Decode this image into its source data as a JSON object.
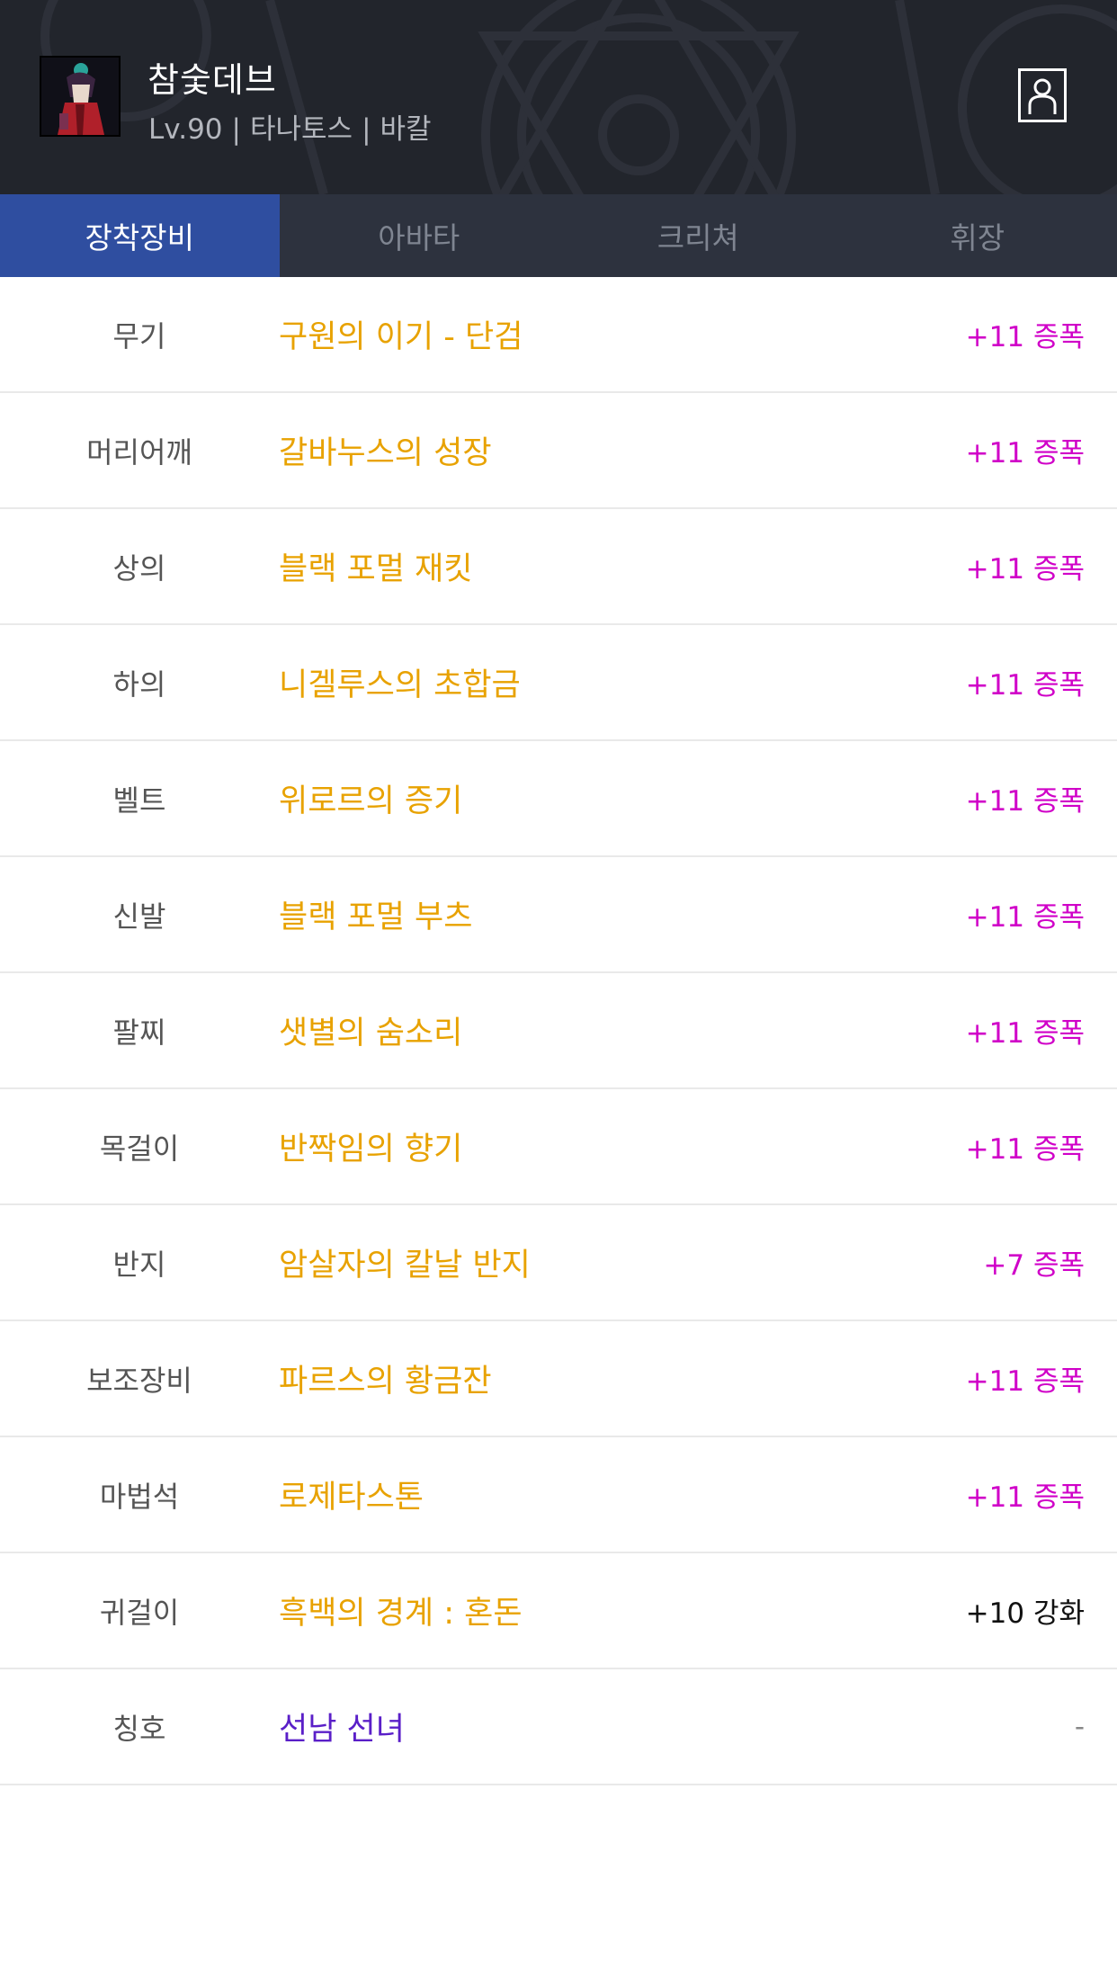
{
  "header": {
    "character_name": "참숯데브",
    "level": "Lv.90",
    "job": "타나토스",
    "server": "바칼",
    "separator": "|",
    "avatar_icon": "character-portrait-icon",
    "profile_icon": "person-outline-icon"
  },
  "tabs": [
    {
      "label": "장착장비",
      "active": true
    },
    {
      "label": "아바타",
      "active": false
    },
    {
      "label": "크리쳐",
      "active": false
    },
    {
      "label": "휘장",
      "active": false
    }
  ],
  "equipment": [
    {
      "slot": "무기",
      "name": "구원의 이기 - 단검",
      "tag": "+11 증폭",
      "tag_style": "amplify"
    },
    {
      "slot": "머리어깨",
      "name": "갈바누스의 성장",
      "tag": "+11 증폭",
      "tag_style": "amplify"
    },
    {
      "slot": "상의",
      "name": "블랙 포멀 재킷",
      "tag": "+11 증폭",
      "tag_style": "amplify"
    },
    {
      "slot": "하의",
      "name": "니겔루스의 초합금",
      "tag": "+11 증폭",
      "tag_style": "amplify"
    },
    {
      "slot": "벨트",
      "name": "위로르의 증기",
      "tag": "+11 증폭",
      "tag_style": "amplify"
    },
    {
      "slot": "신발",
      "name": "블랙 포멀 부츠",
      "tag": "+11 증폭",
      "tag_style": "amplify"
    },
    {
      "slot": "팔찌",
      "name": "샛별의 숨소리",
      "tag": "+11 증폭",
      "tag_style": "amplify"
    },
    {
      "slot": "목걸이",
      "name": "반짝임의 향기",
      "tag": "+11 증폭",
      "tag_style": "amplify"
    },
    {
      "slot": "반지",
      "name": "암살자의 칼날 반지",
      "tag": "+7 증폭",
      "tag_style": "amplify"
    },
    {
      "slot": "보조장비",
      "name": "파르스의 황금잔",
      "tag": "+11 증폭",
      "tag_style": "amplify"
    },
    {
      "slot": "마법석",
      "name": "로제타스톤",
      "tag": "+11 증폭",
      "tag_style": "amplify"
    },
    {
      "slot": "귀걸이",
      "name": "흑백의 경계 : 혼돈",
      "tag": "+10 강화",
      "tag_style": "reinforce"
    },
    {
      "slot": "칭호",
      "name": "선남 선녀",
      "tag": "-",
      "tag_style": "none"
    }
  ],
  "colors": {
    "header_bg": "#22252c",
    "tab_bar_bg": "#2d323e",
    "tab_active_bg": "#2f4ea0",
    "item_unique": "#e8a200",
    "item_rare_title": "#5a1fc8",
    "amplify": "#d000c8",
    "reinforce": "#111111"
  }
}
